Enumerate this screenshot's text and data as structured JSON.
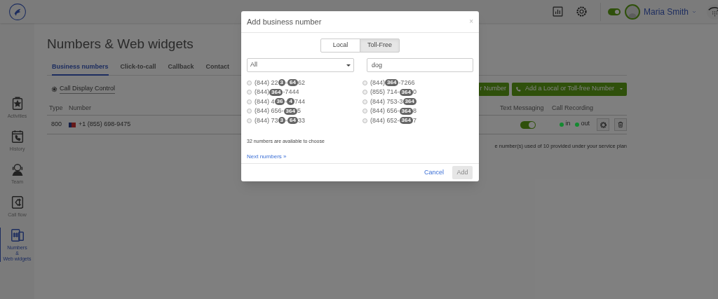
{
  "top_bar": {
    "status_on": true,
    "user_name": "Maria Smith"
  },
  "sidebar": {
    "items": [
      {
        "label": "Activities",
        "selected": false
      },
      {
        "label": "History",
        "selected": false
      },
      {
        "label": "Team",
        "selected": false
      },
      {
        "label": "Call flow",
        "selected": false
      },
      {
        "label": "Numbers\n&\nWeb widgets",
        "selected": true
      }
    ]
  },
  "page": {
    "title": "Numbers & Web widgets",
    "tabs": [
      {
        "label": "Business numbers",
        "selected": true
      },
      {
        "label": "Click-to-call",
        "selected": false
      },
      {
        "label": "Callback",
        "selected": false
      },
      {
        "label": "Contact",
        "selected": false
      }
    ],
    "call_display_control": "Call Display Control",
    "buttons": [
      {
        "label": "r Number",
        "kind": "plain"
      },
      {
        "label": "Add a Local or Toll-free Number",
        "kind": "split"
      }
    ],
    "table": {
      "columns": [
        "Type",
        "Number",
        "Text Messaging",
        "Call Recording"
      ],
      "rows": [
        {
          "type": "800",
          "number": "+1 (855) 698-9475",
          "text_messaging_on": true,
          "recording": [
            {
              "label": "in",
              "color": "#148a30"
            },
            {
              "label": "out",
              "color": "#148a30"
            }
          ]
        }
      ]
    },
    "footer_note": "e number(s) used of 10 provided under your service plan"
  },
  "dialog": {
    "title": "Add business number",
    "close": "×",
    "number_types": [
      {
        "label": "Local",
        "selected": false
      },
      {
        "label": "Toll-Free",
        "selected": true
      }
    ],
    "region_select": "All",
    "search": "dog",
    "numbers": [
      {
        "selected": false,
        "parts": [
          {
            "text": "(844) 22",
            "match": false
          },
          {
            "text": "3",
            "match": true
          },
          {
            "text": "-",
            "match": false
          },
          {
            "text": "64",
            "match": true
          },
          {
            "text": "62",
            "match": false
          }
        ]
      },
      {
        "selected": false,
        "parts": [
          {
            "text": "(844) ",
            "match": false
          },
          {
            "text": "364",
            "match": true
          },
          {
            "text": "-7444",
            "match": false
          }
        ]
      },
      {
        "selected": false,
        "parts": [
          {
            "text": "(844) 4",
            "match": false
          },
          {
            "text": "36",
            "match": true
          },
          {
            "text": "-",
            "match": false
          },
          {
            "text": "4",
            "match": true
          },
          {
            "text": "744",
            "match": false
          }
        ]
      },
      {
        "selected": false,
        "parts": [
          {
            "text": "(844) 656-",
            "match": false
          },
          {
            "text": "364",
            "match": true
          },
          {
            "text": "5",
            "match": false
          }
        ]
      },
      {
        "selected": false,
        "parts": [
          {
            "text": "(844) 73",
            "match": false
          },
          {
            "text": "3",
            "match": true
          },
          {
            "text": "-",
            "match": false
          },
          {
            "text": "64",
            "match": true
          },
          {
            "text": "33",
            "match": false
          }
        ]
      },
      {
        "selected": false,
        "parts": [
          {
            "text": "(844) ",
            "match": false
          },
          {
            "text": "364",
            "match": true
          },
          {
            "text": "-7266",
            "match": false
          }
        ]
      },
      {
        "selected": false,
        "parts": [
          {
            "text": "(855) 714-",
            "match": false
          },
          {
            "text": "364",
            "match": true
          },
          {
            "text": "0",
            "match": false
          }
        ]
      },
      {
        "selected": false,
        "parts": [
          {
            "text": "(844) 753-3",
            "match": false
          },
          {
            "text": "364",
            "match": true
          }
        ]
      },
      {
        "selected": false,
        "parts": [
          {
            "text": "(844) 656-",
            "match": false
          },
          {
            "text": "364",
            "match": true
          },
          {
            "text": "8",
            "match": false
          }
        ]
      },
      {
        "selected": false,
        "parts": [
          {
            "text": "(844) 652-",
            "match": false
          },
          {
            "text": "364",
            "match": true
          },
          {
            "text": "7",
            "match": false
          }
        ]
      }
    ],
    "available_text": "32 numbers are available to choose",
    "next_link": "Next numbers »",
    "cancel": "Cancel",
    "add": {
      "label": "Add",
      "disabled": true
    }
  }
}
